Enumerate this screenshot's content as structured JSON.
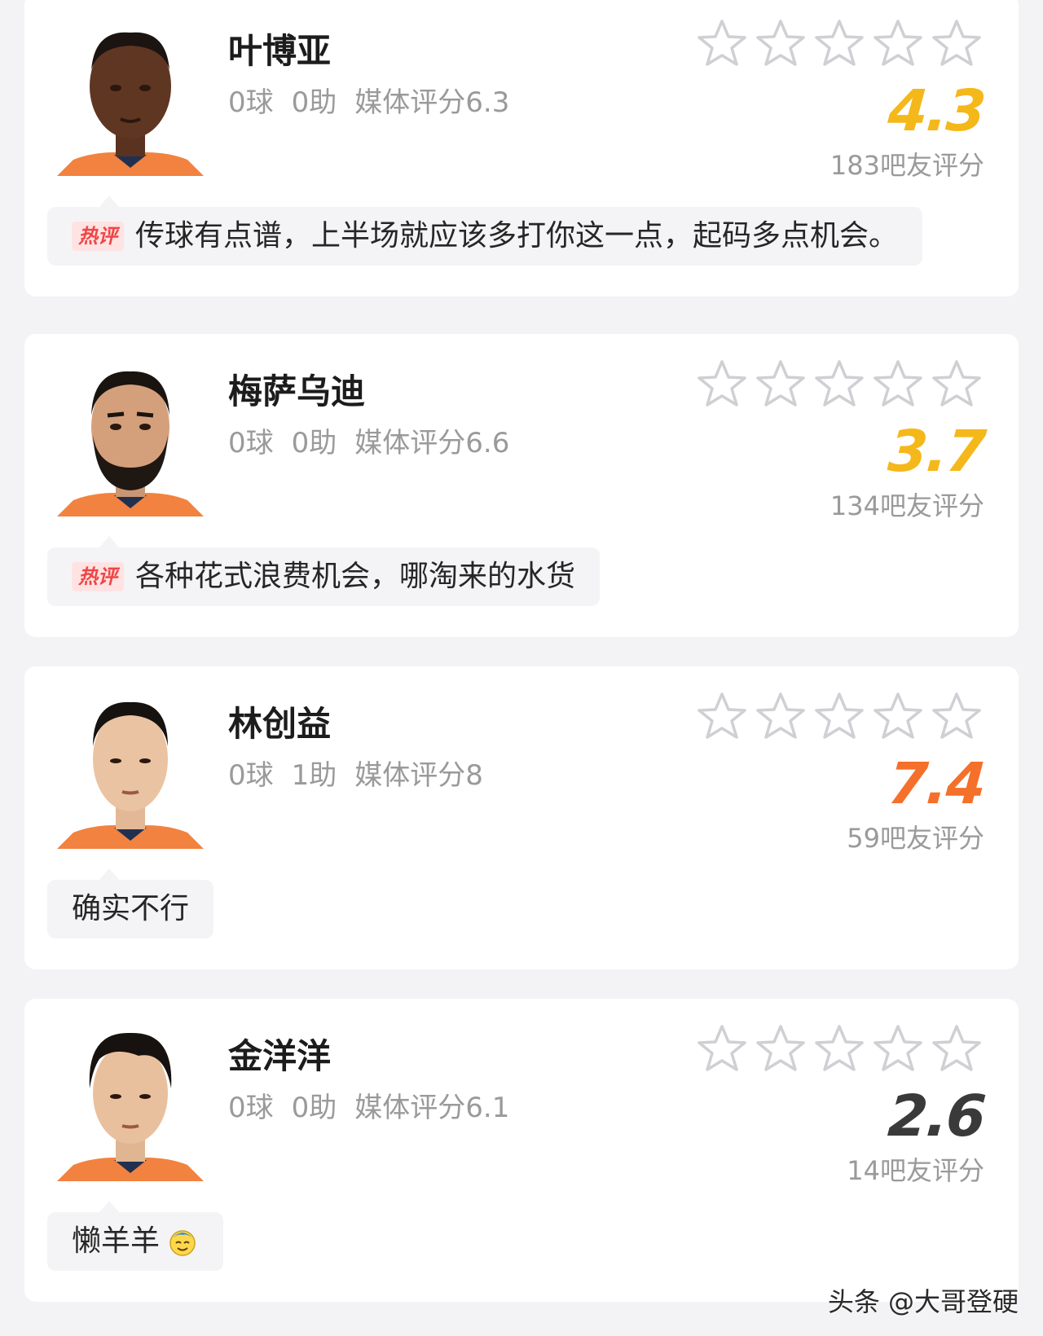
{
  "colors": {
    "score_yellow": "#f5b81a",
    "score_orange": "#f5702a",
    "score_dark": "#3a3a3a",
    "hot_badge_red": "#f04545"
  },
  "players": [
    {
      "name": "叶博亚",
      "goals": "0球",
      "assists": "0助",
      "media_rating": "媒体评分6.3",
      "rating_stars": 0,
      "fan_score": "4.3",
      "fan_score_color": "#f5b81a",
      "fan_count": "183吧友评分",
      "comment": {
        "hot_label": "热评",
        "text": "传球有点谱，上半场就应该多打你这一点，起码多点机会。"
      }
    },
    {
      "name": "梅萨乌迪",
      "goals": "0球",
      "assists": "0助",
      "media_rating": "媒体评分6.6",
      "rating_stars": 0,
      "fan_score": "3.7",
      "fan_score_color": "#f5b81a",
      "fan_count": "134吧友评分",
      "comment": {
        "hot_label": "热评",
        "text": "各种花式浪费机会，哪淘来的水货"
      }
    },
    {
      "name": "林创益",
      "goals": "0球",
      "assists": "1助",
      "media_rating": "媒体评分8",
      "rating_stars": 0,
      "fan_score": "7.4",
      "fan_score_color": "#f5702a",
      "fan_count": "59吧友评分",
      "comment": {
        "hot_label": "",
        "text": "确实不行"
      }
    },
    {
      "name": "金洋洋",
      "goals": "0球",
      "assists": "0助",
      "media_rating": "媒体评分6.1",
      "rating_stars": 0,
      "fan_score": "2.6",
      "fan_score_color": "#3a3a3a",
      "fan_count": "14吧友评分",
      "comment": {
        "hot_label": "",
        "text": "懒羊羊",
        "emoji": "smiling-face-icon"
      }
    }
  ],
  "watermark": "头条 @大哥登硬"
}
